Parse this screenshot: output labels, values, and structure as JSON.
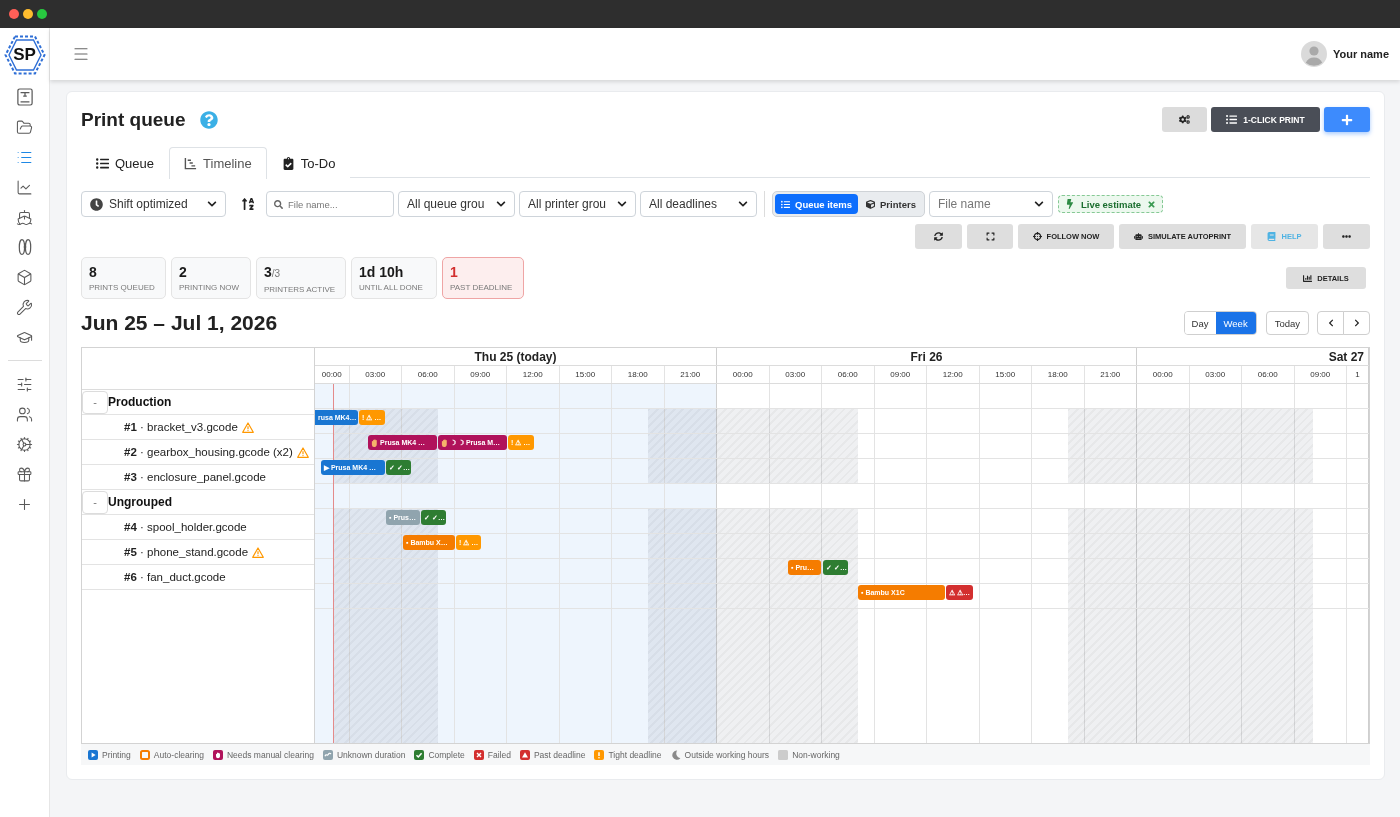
{
  "logo": {
    "text": "SP"
  },
  "sidebar": {
    "sections": [
      {
        "items": [
          {
            "kind": "printer",
            "selected": false
          },
          {
            "kind": "folder",
            "selected": false
          },
          {
            "kind": "list",
            "selected": true
          },
          {
            "kind": "chart",
            "selected": false
          },
          {
            "kind": "ship",
            "selected": false
          },
          {
            "kind": "spool",
            "selected": false
          },
          {
            "kind": "cube",
            "selected": false
          },
          {
            "kind": "wrench",
            "selected": false
          },
          {
            "kind": "cap",
            "selected": false
          }
        ]
      },
      {
        "items": [
          {
            "kind": "sliders",
            "selected": false
          },
          {
            "kind": "users",
            "selected": false
          },
          {
            "kind": "gears",
            "selected": false
          },
          {
            "kind": "gift",
            "selected": false
          },
          {
            "kind": "plus",
            "selected": false
          }
        ]
      }
    ]
  },
  "header": {
    "user_name": "Your name"
  },
  "page": {
    "title": "Print queue"
  },
  "actions": [
    {
      "kind": "settings"
    },
    {
      "kind": "one_click",
      "label": "1-CLICK PRINT"
    },
    {
      "kind": "add"
    }
  ],
  "tabs": [
    {
      "kind": "queue",
      "label": "Queue",
      "selected": false
    },
    {
      "kind": "timeline",
      "label": "Timeline",
      "selected": true
    },
    {
      "kind": "todo",
      "label": "To-Do",
      "selected": false
    }
  ],
  "filters": {
    "mode_select": {
      "value": "Shift optimized"
    },
    "search": {
      "placeholder": "File name..."
    },
    "selects": [
      {
        "value": "All queue grou"
      },
      {
        "value": "All printer grou"
      },
      {
        "value": "All deadlines"
      }
    ],
    "view_toggle": [
      {
        "kind": "queue_items",
        "label": "Queue items",
        "selected": true
      },
      {
        "kind": "printers",
        "label": "Printers",
        "selected": false
      }
    ],
    "file_select": {
      "placeholder": "File name"
    },
    "badge": {
      "label": "Live estimate"
    }
  },
  "toolbar": [
    {
      "kind": "refresh"
    },
    {
      "kind": "fullscreen"
    },
    {
      "kind": "follow",
      "label": "FOLLOW NOW"
    },
    {
      "kind": "simulate",
      "label": "SIMULATE AUTOPRINT"
    },
    {
      "kind": "help",
      "label": "HELP"
    },
    {
      "kind": "more"
    }
  ],
  "stats": [
    {
      "value": "8",
      "label": "PRINTS QUEUED",
      "alert": false
    },
    {
      "value": "2",
      "label": "PRINTING NOW",
      "alert": false
    },
    {
      "value": "3",
      "total": "/3",
      "label": "PRINTERS ACTIVE",
      "alert": false
    },
    {
      "value": "1d 10h",
      "label": "UNTIL ALL DONE",
      "alert": false
    },
    {
      "value": "1",
      "label": "PAST DEADLINE",
      "alert": true
    }
  ],
  "details_button": {
    "label": "DETAILS"
  },
  "date_range": "Jun 25 – Jul 1, 2026",
  "range_toggle": [
    {
      "label": "Day",
      "selected": false
    },
    {
      "label": "Week",
      "selected": true
    }
  ],
  "today_button": {
    "label": "Today"
  },
  "timeline": {
    "groups": [
      {
        "name": "Production",
        "toggle": "-",
        "expanded": true,
        "children": [
          {
            "label": "**#1** · bracket_v3.gcode",
            "warning": true
          },
          {
            "label": "**#2** · gearbox_housing.gcode (x2)",
            "warning": true
          },
          {
            "label": "**#3** · enclosure_panel.gcode",
            "warning": false
          }
        ]
      },
      {
        "name": "Ungrouped",
        "toggle": "-",
        "expanded": true,
        "children": [
          {
            "label": "**#4** · spool_holder.gcode",
            "warning": false
          },
          {
            "label": "**#5** · phone_stand.gcode",
            "warning": true
          },
          {
            "label": "**#6** · fan_duct.gcode",
            "warning": false
          }
        ]
      }
    ],
    "days": [
      {
        "label": "Thu 25 (today)",
        "today": true,
        "hours": [
          "00:00",
          "03:00",
          "06:00",
          "09:00",
          "12:00",
          "15:00",
          "18:00",
          "21:00"
        ]
      },
      {
        "label": "Fri 26",
        "today": false,
        "hours": [
          "00:00",
          "03:00",
          "06:00",
          "09:00",
          "12:00",
          "15:00",
          "18:00",
          "21:00"
        ]
      },
      {
        "label": "Sat 27",
        "today": false,
        "hours": [
          "00:00",
          "03:00",
          "06:00",
          "09:00",
          "1"
        ]
      }
    ],
    "rows": [
      {
        "kind": "group"
      },
      {
        "kind": "item",
        "bars": [
          {
            "kind": "printing",
            "label": "rusa MK4…"
          },
          {
            "kind": "tight_deadline",
            "label": "! ⚠ …"
          }
        ]
      },
      {
        "kind": "item",
        "bars": [
          {
            "kind": "manual_clearing",
            "label": "Prusa MK4 …"
          },
          {
            "kind": "manual_clearing",
            "label": "☽ ☽ Prusa M…"
          },
          {
            "kind": "tight_deadline",
            "label": "! ⚠ …"
          }
        ]
      },
      {
        "kind": "item",
        "bars": [
          {
            "kind": "printing",
            "label": "▶ Prusa MK4 …"
          },
          {
            "kind": "complete",
            "label": "✓ ✓…"
          }
        ]
      },
      {
        "kind": "group"
      },
      {
        "kind": "item",
        "bars": [
          {
            "kind": "unknown_duration",
            "label": "▪ Prus…"
          },
          {
            "kind": "complete",
            "label": "✓ ✓…"
          }
        ]
      },
      {
        "kind": "item",
        "bars": [
          {
            "kind": "auto_clearing",
            "label": "▪ Bambu X…"
          },
          {
            "kind": "tight_deadline",
            "label": "! ⚠ …"
          }
        ]
      },
      {
        "kind": "item",
        "bars": [
          {
            "kind": "auto_clearing",
            "label": "▪ Pru…"
          },
          {
            "kind": "complete",
            "label": "✓ ✓…"
          }
        ]
      },
      {
        "kind": "item",
        "bars": [
          {
            "kind": "auto_clearing",
            "label": "▪ Bambu X1C"
          },
          {
            "kind": "past_deadline",
            "label": "⚠ ⚠…"
          }
        ]
      }
    ]
  },
  "legend": [
    {
      "kind": "printing",
      "label": "Printing",
      "color": "#1976d2"
    },
    {
      "kind": "auto_clearing",
      "label": "Auto-clearing",
      "color": "#f57c00"
    },
    {
      "kind": "manual_clearing",
      "label": "Needs manual clearing",
      "color": "#b0125b"
    },
    {
      "kind": "unknown_duration",
      "label": "Unknown duration",
      "color": "#90a4ae"
    },
    {
      "kind": "complete",
      "label": "Complete",
      "color": "#2e7d32"
    },
    {
      "kind": "failed",
      "label": "Failed",
      "color": "#d32f2f"
    },
    {
      "kind": "past_deadline",
      "label": "Past deadline",
      "color": "#d32f2f"
    },
    {
      "kind": "tight_deadline",
      "label": "Tight deadline",
      "color": "#ff9800"
    },
    {
      "kind": "outside_hours",
      "label": "Outside working hours",
      "color": "#8a8a8a"
    },
    {
      "kind": "non_working",
      "label": "Non-working",
      "color": "#cccccc"
    }
  ]
}
